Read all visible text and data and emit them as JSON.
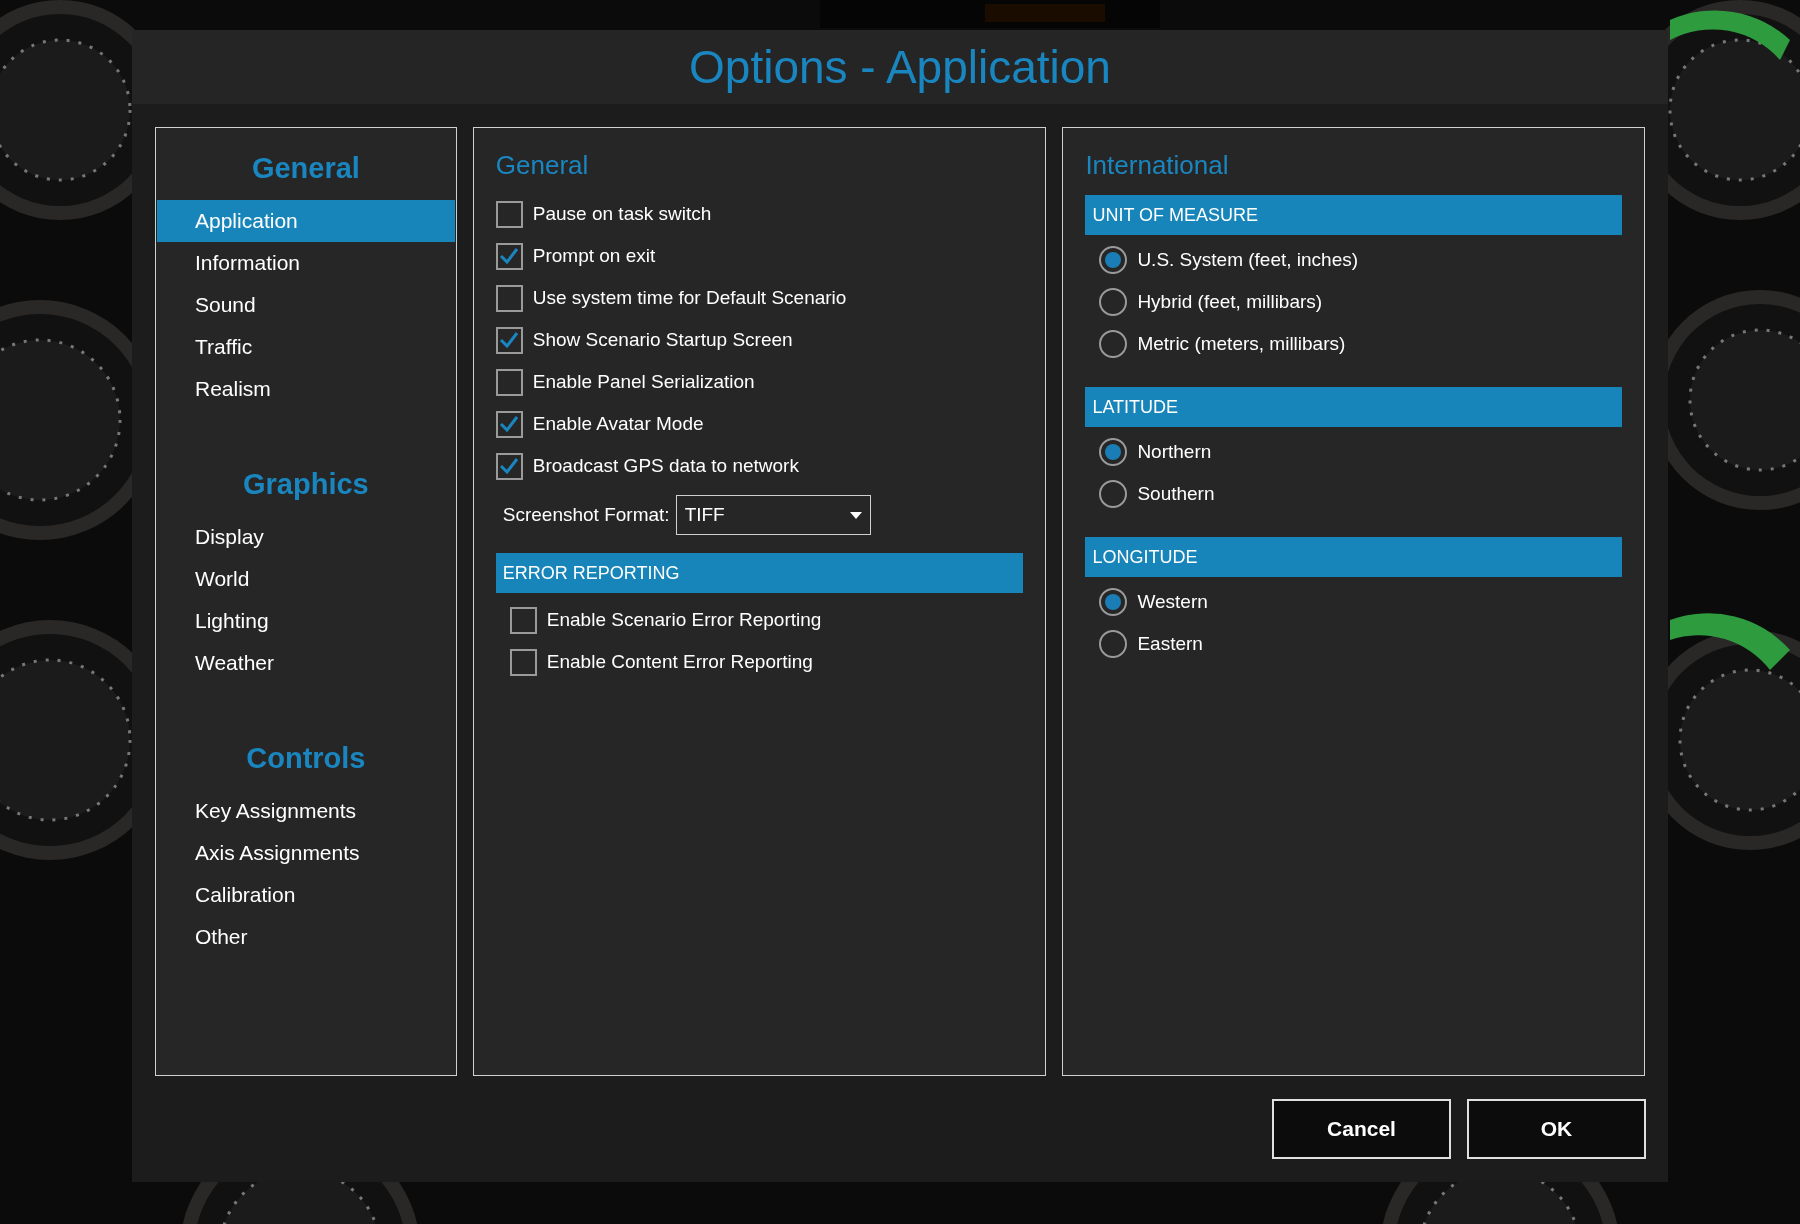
{
  "window": {
    "title": "Options - Application"
  },
  "sidebar": {
    "groups": [
      {
        "title": "General",
        "items": [
          {
            "label": "Application",
            "selected": true
          },
          {
            "label": "Information",
            "selected": false
          },
          {
            "label": "Sound",
            "selected": false
          },
          {
            "label": "Traffic",
            "selected": false
          },
          {
            "label": "Realism",
            "selected": false
          }
        ]
      },
      {
        "title": "Graphics",
        "items": [
          {
            "label": "Display",
            "selected": false
          },
          {
            "label": "World",
            "selected": false
          },
          {
            "label": "Lighting",
            "selected": false
          },
          {
            "label": "Weather",
            "selected": false
          }
        ]
      },
      {
        "title": "Controls",
        "items": [
          {
            "label": "Key Assignments",
            "selected": false
          },
          {
            "label": "Axis Assignments",
            "selected": false
          },
          {
            "label": "Calibration",
            "selected": false
          },
          {
            "label": "Other",
            "selected": false
          }
        ]
      }
    ]
  },
  "general": {
    "title": "General",
    "options": [
      {
        "label": "Pause on task switch",
        "checked": false
      },
      {
        "label": "Prompt on exit",
        "checked": true
      },
      {
        "label": "Use system time for Default Scenario",
        "checked": false
      },
      {
        "label": "Show Scenario Startup Screen",
        "checked": true
      },
      {
        "label": "Enable Panel Serialization",
        "checked": false
      },
      {
        "label": "Enable Avatar Mode",
        "checked": true
      },
      {
        "label": "Broadcast GPS data to network",
        "checked": true
      }
    ],
    "screenshot_format": {
      "label": "Screenshot Format:",
      "value": "TIFF"
    },
    "error_reporting": {
      "title": "ERROR REPORTING",
      "options": [
        {
          "label": "Enable Scenario Error Reporting",
          "checked": false
        },
        {
          "label": "Enable Content Error Reporting",
          "checked": false
        }
      ]
    }
  },
  "international": {
    "title": "International",
    "sections": [
      {
        "title": "UNIT OF MEASURE",
        "options": [
          {
            "label": "U.S. System (feet, inches)",
            "selected": true
          },
          {
            "label": "Hybrid (feet, millibars)",
            "selected": false
          },
          {
            "label": "Metric (meters, millibars)",
            "selected": false
          }
        ]
      },
      {
        "title": "LATITUDE",
        "options": [
          {
            "label": "Northern",
            "selected": true
          },
          {
            "label": "Southern",
            "selected": false
          }
        ]
      },
      {
        "title": "LONGITUDE",
        "options": [
          {
            "label": "Western",
            "selected": true
          },
          {
            "label": "Eastern",
            "selected": false
          }
        ]
      }
    ]
  },
  "buttons": [
    "Cancel",
    "OK"
  ]
}
